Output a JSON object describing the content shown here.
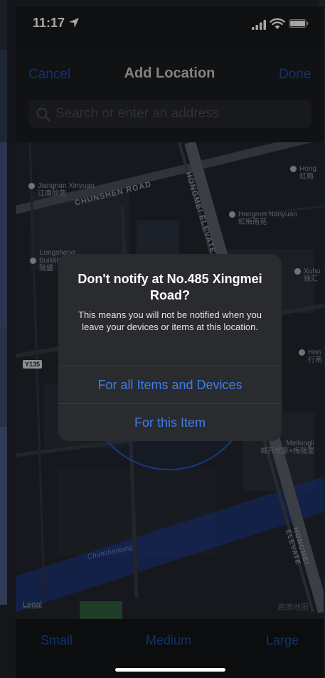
{
  "status_bar": {
    "time": "11:17",
    "icons": [
      "location-arrow-icon",
      "signal-icon",
      "wifi-icon",
      "battery-icon"
    ]
  },
  "nav": {
    "cancel_label": "Cancel",
    "title": "Add Location",
    "done_label": "Done"
  },
  "search": {
    "placeholder": "Search or enter an address",
    "value": ""
  },
  "map": {
    "top_label": "Jiangnan Xinyuan",
    "labels": {
      "jiangnan_en": "Jiangnan Xinyuan",
      "jiangnan_cn": "江南欣苑",
      "chunshen_road": "CHUNSHEN ROAD",
      "hongmei_elevated_top": "HONGMEI ELEVATE",
      "hongmei_nanyuan_en": "Hongmei Nanyuan",
      "hongmei_nanyuan_cn": "虹梅南苑",
      "hong_cn": "虹梅",
      "hong_en": "Hong",
      "longsheng_en": "Longsheng",
      "longsheng_building": "Building",
      "longsheng_cn": "陇盛",
      "xuhui_en": "Xuhu",
      "xuhui_cn": "徐汇",
      "han_en": "Han",
      "han_cn": "行南",
      "y135": "Y135",
      "meilongli_en": "Meilongli",
      "meilongli_cn": "城开优享+梅陇里",
      "chunshentang": "Chunshentang",
      "hongmei_elevated_bottom": "HONGMEI ELEVATE"
    },
    "legal_label": "Legal",
    "attribution": "高德地图"
  },
  "alert": {
    "title": "Don't notify at No.485 Xingmei Road?",
    "message": "This means you will not be notified when you leave your devices or items at this location.",
    "buttons": [
      "For all Items and Devices",
      "For this Item"
    ]
  },
  "size_options": {
    "small": "Small",
    "medium": "Medium",
    "large": "Large"
  },
  "colors": {
    "accent_dim": "#1f4ea7",
    "alert_button": "#3f7de6",
    "alert_bg": "#2a2b2f",
    "map_bg": "#22262e"
  }
}
